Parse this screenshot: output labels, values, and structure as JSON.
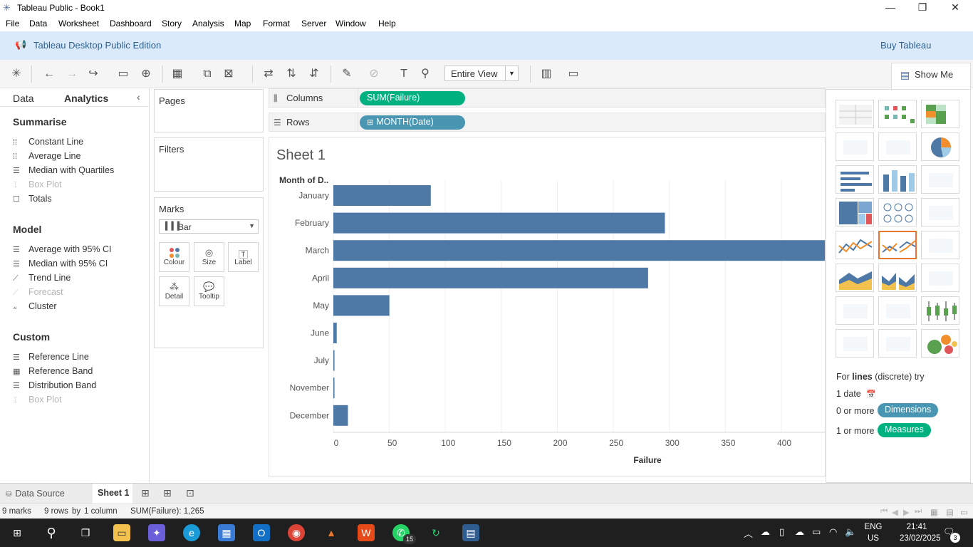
{
  "window": {
    "title": "Tableau Public - Book1",
    "minimize": "—",
    "maximize": "❐",
    "close": "✕"
  },
  "menu": [
    "File",
    "Data",
    "Worksheet",
    "Dashboard",
    "Story",
    "Analysis",
    "Map",
    "Format",
    "Server",
    "Window",
    "Help"
  ],
  "banner": {
    "edition": "Tableau Desktop Public Edition",
    "buy": "Buy Tableau"
  },
  "toolbar": {
    "fit": "Entire View",
    "show_me": "Show Me"
  },
  "left_pane": {
    "tab_data": "Data",
    "tab_analytics": "Analytics",
    "sections": [
      {
        "title": "Summarise",
        "items": [
          {
            "label": "Constant Line",
            "enabled": true
          },
          {
            "label": "Average Line",
            "enabled": true
          },
          {
            "label": "Median with Quartiles",
            "enabled": true
          },
          {
            "label": "Box Plot",
            "enabled": false
          },
          {
            "label": "Totals",
            "enabled": true
          }
        ]
      },
      {
        "title": "Model",
        "items": [
          {
            "label": "Average with 95% CI",
            "enabled": true
          },
          {
            "label": "Median with 95% CI",
            "enabled": true
          },
          {
            "label": "Trend Line",
            "enabled": true
          },
          {
            "label": "Forecast",
            "enabled": false
          },
          {
            "label": "Cluster",
            "enabled": true
          }
        ]
      },
      {
        "title": "Custom",
        "items": [
          {
            "label": "Reference Line",
            "enabled": true
          },
          {
            "label": "Reference Band",
            "enabled": true
          },
          {
            "label": "Distribution Band",
            "enabled": true
          },
          {
            "label": "Box Plot",
            "enabled": false
          }
        ]
      }
    ]
  },
  "cards": {
    "pages": "Pages",
    "filters": "Filters",
    "marks": "Marks",
    "mark_type": "Bar",
    "buttons": [
      "Colour",
      "Size",
      "Label",
      "Detail",
      "Tooltip"
    ]
  },
  "shelves": {
    "columns_label": "Columns",
    "columns_pill": "SUM(Failure)",
    "rows_label": "Rows",
    "rows_pill": "MONTH(Date)"
  },
  "colors": {
    "bar": "#4e79a7",
    "measure_pill": "#00b180",
    "dimension_pill": "#4996b2",
    "selected_thumb": "#e8762d"
  },
  "sheet": {
    "title": "Sheet 1"
  },
  "chart_data": {
    "type": "bar",
    "orientation": "horizontal",
    "row_header": "Month of D..",
    "categories": [
      "January",
      "February",
      "March",
      "April",
      "May",
      "June",
      "July",
      "November",
      "December"
    ],
    "values": [
      87,
      296,
      450,
      281,
      50,
      3,
      1,
      1,
      13
    ],
    "xlabel": "Failure",
    "xticks": [
      0,
      50,
      100,
      150,
      200,
      250,
      300,
      350,
      400
    ],
    "xlim": [
      0,
      440
    ],
    "grid": true
  },
  "show_me": {
    "hint_prefix": "For",
    "hint_bold": "lines",
    "hint_suffix": "(discrete) try",
    "req_date": "1 date",
    "req_dim_prefix": "0 or more",
    "req_dim": "Dimensions",
    "req_meas_prefix": "1 or more",
    "req_meas": "Measures"
  },
  "tabs": {
    "data_source": "Data Source",
    "sheet1": "Sheet 1"
  },
  "status": {
    "marks": "9 marks",
    "rows": "9 rows",
    "by": "by",
    "columns": "1 column",
    "sum": "SUM(Failure): 1,265"
  },
  "taskbar": {
    "language": "ENG",
    "region": "US",
    "time": "21:41",
    "date": "23/02/2025",
    "whatsapp_badge": "15",
    "notif_badge": "3"
  }
}
